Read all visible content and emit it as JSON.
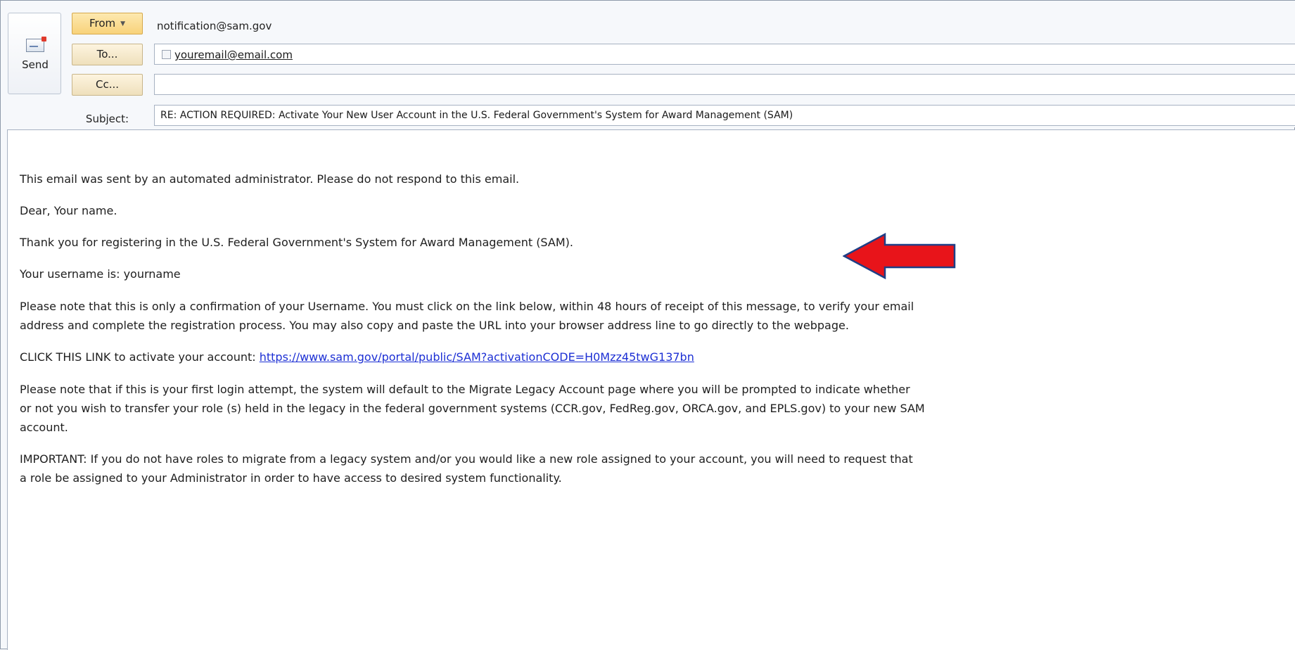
{
  "header": {
    "send_label": "Send",
    "from_button": "From",
    "from_address": "notification@sam.gov",
    "to_button": "To...",
    "to_address": "youremail@email.com",
    "cc_button": "Cc...",
    "cc_value": "",
    "subject_label": "Subject:",
    "subject_value": "RE: ACTION REQUIRED: Activate Your New User Account in the U.S. Federal Government's System for Award Management (SAM)"
  },
  "body": {
    "p1": "This email was sent by an automated administrator. Please do not respond to this email.",
    "p2": "Dear, Your name.",
    "p3": "Thank you for registering in the U.S. Federal Government's System for Award Management (SAM).",
    "p4": "Your username is: yourname",
    "p5_line1": "Please note that this is only a confirmation of your Username. You must click on the link below, within 48 hours of receipt of this message, to verify your email",
    "p5_line2": "address and complete the registration process. You may also copy and paste the URL into your browser address line to go directly to the webpage.",
    "p6_prefix": "CLICK THIS LINK to activate your account: ",
    "activation_link": "https://www.sam.gov/portal/public/SAM?activationCODE=H0Mzz45twG137bn",
    "p7_line1": "Please note that if this is your first login attempt, the system will default to the Migrate Legacy Account page where you will be prompted to indicate whether",
    "p7_line2": "or not you wish to transfer your role (s) held in the legacy in the federal government systems (CCR.gov, FedReg.gov, ORCA.gov, and EPLS.gov) to your new SAM",
    "p7_line3": "account.",
    "p8_line1": "IMPORTANT: If you do not have roles to migrate from a legacy system and/or you would like a new role assigned to your account, you will need to request that",
    "p8_line2": "a role be assigned to your Administrator in order to have access to desired system functionality."
  },
  "colors": {
    "link": "#1c2fd4",
    "arrow": "#e8141a",
    "from_button": "#f8d27a"
  }
}
